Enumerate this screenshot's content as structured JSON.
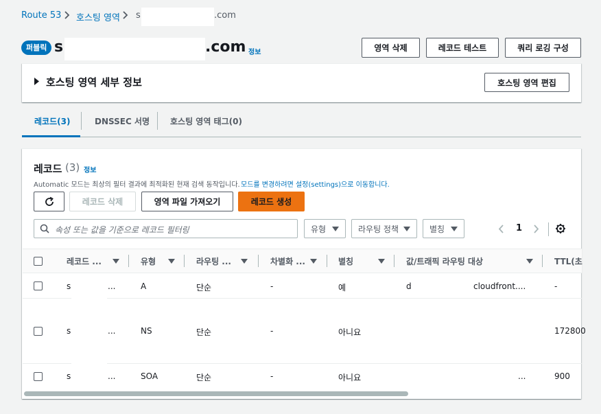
{
  "breadcrumb": {
    "items": [
      "Route 53",
      "호스팅 영역",
      "s",
      ".com"
    ]
  },
  "header": {
    "badge": "퍼블릭",
    "domain_prefix": "s",
    "domain_suffix": ".com",
    "info": "정보",
    "buttons": [
      "영역 삭제",
      "레코드 테스트",
      "쿼리 로깅 구성"
    ]
  },
  "details": {
    "title": "호스팅 영역 세부 정보",
    "edit_button": "호스팅 영역 편집"
  },
  "tabs": [
    "레코드(3)",
    "DNSSEC 서명",
    "호스팅 영역 태그(0)"
  ],
  "records": {
    "title": "레코드",
    "count": "(3)",
    "info": "정보",
    "description": "Automatic 모드는 최상의 필터 결과에 최적화된 현재 검색 동작입니다.",
    "description_link": "모드를 변경하려면 설정(settings)으로 이동합니다.",
    "buttons": {
      "delete": "레코드 삭제",
      "import": "영역 파일 가져오기",
      "create": "레코드 생성"
    },
    "search_placeholder": "속성 또는 값을 기준으로 레코드 필터링",
    "filters": [
      "유형",
      "라우팅 정책",
      "별칭"
    ],
    "page": "1",
    "columns": [
      "레코드 ...",
      "유형",
      "라우팅 ...",
      "차별화 ...",
      "별칭",
      "값/트래픽 라우팅 대상",
      "TTL(초"
    ],
    "rows": [
      {
        "name": "s",
        "name_tail": "...",
        "type": "A",
        "routing": "단순",
        "diff": "-",
        "alias": "예",
        "value_prefix": "d",
        "value": "cloudfront....",
        "ttl": "-"
      },
      {
        "name": "s",
        "name_tail": "...",
        "type": "NS",
        "routing": "단순",
        "diff": "-",
        "alias": "아니요",
        "value_prefix": "",
        "value": "",
        "ttl": "172800"
      },
      {
        "name": "s",
        "name_tail": "...",
        "type": "SOA",
        "routing": "단순",
        "diff": "-",
        "alias": "아니요",
        "value_prefix": "",
        "value": "...",
        "ttl": "900"
      }
    ]
  },
  "colors": {
    "link": "#0073bb",
    "primary": "#ec7211",
    "badge": "#0073bb",
    "active_tab": "#0073bb"
  }
}
